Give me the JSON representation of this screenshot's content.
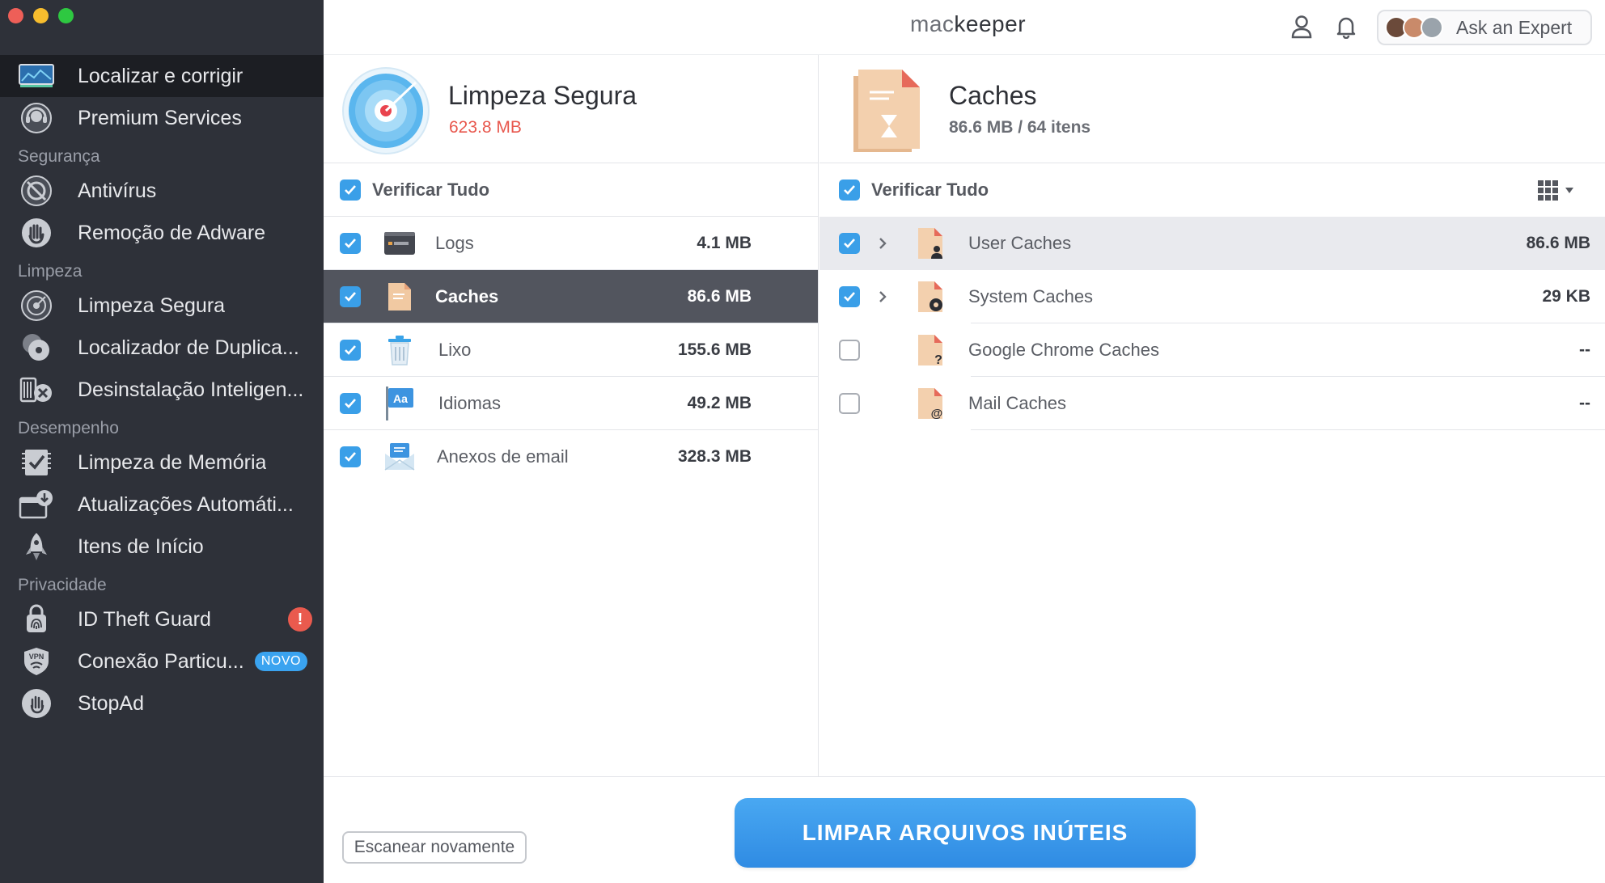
{
  "brand": {
    "prefix": "mac",
    "suffix": "keeper"
  },
  "header": {
    "expert_label": "Ask an Expert"
  },
  "sidebar": {
    "items": [
      {
        "label": "Localizar e corrigir",
        "icon": "monitor-chart-icon"
      },
      {
        "label": "Premium Services",
        "icon": "headset-icon"
      },
      {
        "label": "Antivírus",
        "icon": "shield-strike-icon"
      },
      {
        "label": "Remoção de Adware",
        "icon": "hand-stop-icon"
      },
      {
        "label": "Limpeza Segura",
        "icon": "target-disc-icon"
      },
      {
        "label": "Localizador de Duplica...",
        "icon": "duplicate-discs-icon"
      },
      {
        "label": "Desinstalação Inteligen...",
        "icon": "uninstall-icon"
      },
      {
        "label": "Limpeza de Memória",
        "icon": "memory-check-icon"
      },
      {
        "label": "Atualizações Automáti...",
        "icon": "download-update-icon"
      },
      {
        "label": "Itens de Início",
        "icon": "rocket-icon"
      },
      {
        "label": "ID Theft Guard",
        "icon": "fingerprint-lock-icon",
        "badge": "!"
      },
      {
        "label": "Conexão Particu...",
        "icon": "vpn-shield-icon",
        "badge": "NOVO"
      },
      {
        "label": "StopAd",
        "icon": "stop-hand-icon"
      }
    ],
    "sections": [
      "Segurança",
      "Limpeza",
      "Desempenho",
      "Privacidade"
    ]
  },
  "left_panel": {
    "title": "Limpeza Segura",
    "size": "623.8 MB",
    "check_all": "Verificar Tudo",
    "items": [
      {
        "name": "Logs",
        "size": "4.1 MB",
        "checked": true
      },
      {
        "name": "Caches",
        "size": "86.6 MB",
        "checked": true
      },
      {
        "name": "Lixo",
        "size": "155.6 MB",
        "checked": true
      },
      {
        "name": "Idiomas",
        "size": "49.2 MB",
        "checked": true
      },
      {
        "name": "Anexos de email",
        "size": "328.3 MB",
        "checked": true
      }
    ]
  },
  "right_panel": {
    "title": "Caches",
    "subtitle": "86.6 MB / 64 itens",
    "check_all": "Verificar Tudo",
    "items": [
      {
        "name": "User Caches",
        "size": "86.6 MB",
        "checked": true
      },
      {
        "name": "System Caches",
        "size": "29 KB",
        "checked": true
      },
      {
        "name": "Google Chrome Caches",
        "size": "--",
        "checked": false
      },
      {
        "name": "Mail Caches",
        "size": "--",
        "checked": false
      }
    ]
  },
  "footer": {
    "rescan_label": "Escanear novamente",
    "clean_label": "LIMPAR ARQUIVOS INÚTEIS"
  },
  "colors": {
    "accent": "#3a9fe8",
    "danger": "#ea5a4e",
    "sidebar_bg": "#2e3139"
  }
}
